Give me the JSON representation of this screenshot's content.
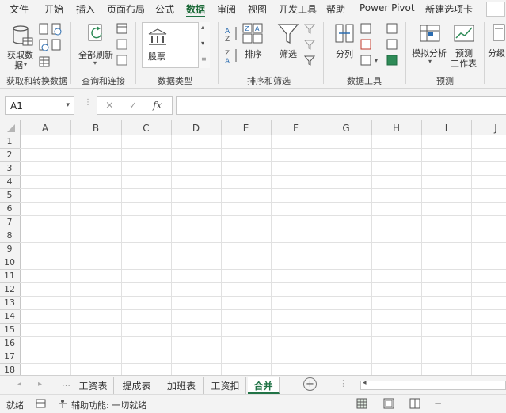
{
  "menu_tabs": [
    "文件",
    "开始",
    "插入",
    "页面布局",
    "公式",
    "数据",
    "审阅",
    "视图",
    "开发工具",
    "帮助",
    "Power Pivot",
    "新建选项卡"
  ],
  "active_tab": "数据",
  "ribbon": {
    "get_data_line1": "获取数",
    "get_data_line2": "据",
    "refresh_all": "全部刷新",
    "stock": "股票",
    "sort": "排序",
    "filter": "筛选",
    "text_to_columns": "分列",
    "what_if": "模拟分析",
    "forecast_line1": "预测",
    "forecast_line2": "工作表",
    "outline": "分级",
    "groups": [
      "获取和转换数据",
      "查询和连接",
      "数据类型",
      "排序和筛选",
      "数据工具",
      "预测"
    ]
  },
  "formula_bar": {
    "name_box": "A1",
    "cancel": "×",
    "enter": "✓",
    "fx": "fx",
    "formula": ""
  },
  "columns": [
    "A",
    "B",
    "C",
    "D",
    "E",
    "F",
    "G",
    "H",
    "I",
    "J"
  ],
  "rows": [
    "1",
    "2",
    "3",
    "4",
    "5",
    "6",
    "7",
    "8",
    "9",
    "10",
    "11",
    "12",
    "13",
    "14",
    "15",
    "16",
    "17",
    "18"
  ],
  "sheets": [
    "工资表",
    "提成表",
    "加班表",
    "工资扣",
    "合并"
  ],
  "active_sheet": "合并",
  "add_sheet": "+",
  "status": {
    "ready": "就绪",
    "accessibility": "辅助功能: 一切就绪"
  },
  "colors": {
    "accent": "#217346",
    "ribbon_bg": "#f3f3f3",
    "gridline": "#e1e1e1"
  }
}
